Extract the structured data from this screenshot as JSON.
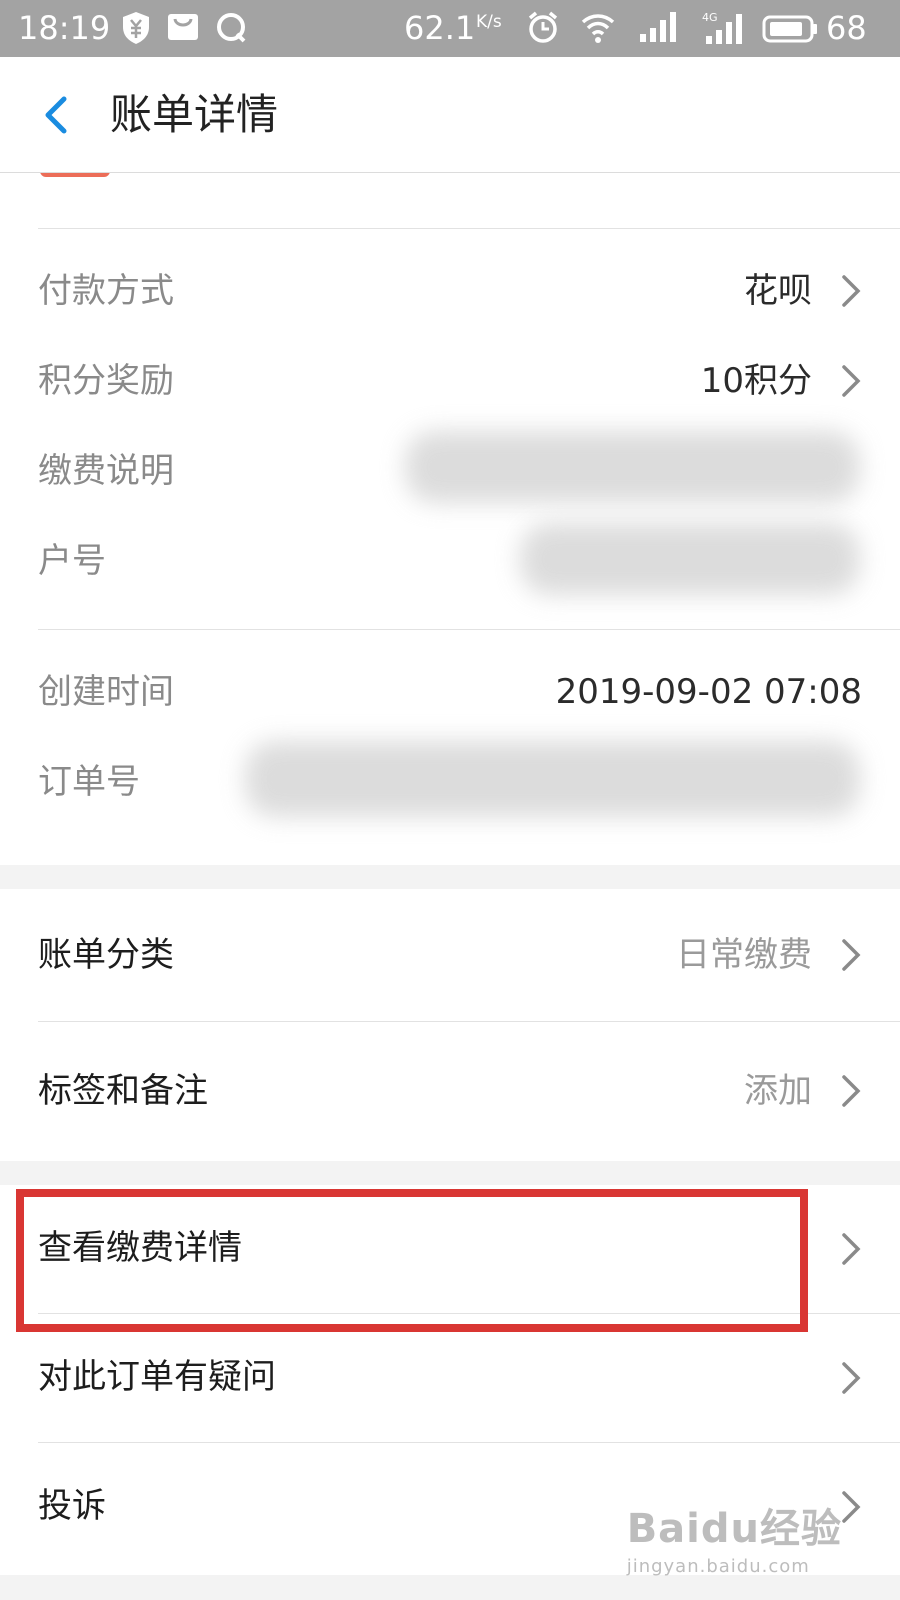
{
  "status_bar": {
    "time": "18:19",
    "net_speed": "62.1",
    "net_speed_unit": "K/s",
    "battery_level": "68",
    "icons": [
      "yuan-shield-icon",
      "mail-icon",
      "q-app-icon",
      "alarm-icon",
      "wifi-icon",
      "signal-icon",
      "signal-4g-icon",
      "battery-icon"
    ]
  },
  "nav": {
    "title": "账单详情",
    "back_icon": "chevron-left-icon"
  },
  "details": {
    "payment_method": {
      "label": "付款方式",
      "value": "花呗"
    },
    "points_reward": {
      "label": "积分奖励",
      "value": "10积分"
    },
    "payment_note": {
      "label": "缴费说明"
    },
    "account_number": {
      "label": "户号"
    },
    "created_time": {
      "label": "创建时间",
      "value": "2019-09-02 07:08"
    },
    "order_number": {
      "label": "订单号"
    }
  },
  "category_section": {
    "bill_category": {
      "label": "账单分类",
      "value": "日常缴费"
    },
    "tags_notes": {
      "label": "标签和备注",
      "value": "添加"
    }
  },
  "actions": {
    "view_payment_detail": {
      "label": "查看缴费详情"
    },
    "order_question": {
      "label": "对此订单有疑问"
    },
    "complaint": {
      "label": "投诉"
    }
  },
  "watermark": {
    "logo": "Baidu经验",
    "url": "jingyan.baidu.com"
  },
  "colors": {
    "accent_blue": "#1a8ce0",
    "highlight_red": "#d93633",
    "status_bar_bg": "#a3a3a3"
  }
}
